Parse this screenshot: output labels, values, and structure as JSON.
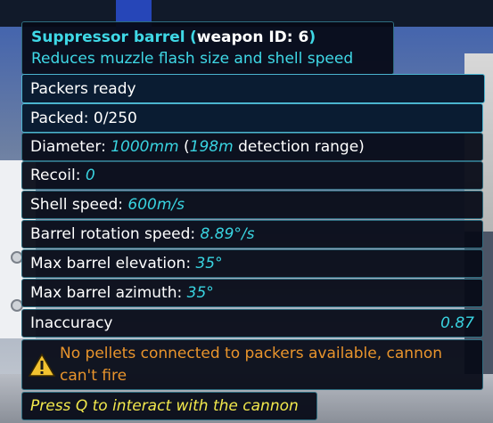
{
  "item": {
    "name": "Suppressor barrel",
    "id_prefix": "(",
    "id_label": "weapon ID: 6",
    "id_suffix": ")",
    "description": "Reduces muzzle flash size and shell speed"
  },
  "status": {
    "packers": "Packers ready",
    "packed_label": "Packed:",
    "packed_value": "0/250"
  },
  "stats": {
    "diameter_label": "Diameter:",
    "diameter_value": "1000mm",
    "diameter_open": "(",
    "detection_value": "198m",
    "detection_label": "detection range)",
    "recoil_label": "Recoil:",
    "recoil_value": "0",
    "shell_speed_label": "Shell speed:",
    "shell_speed_value": "600m/s",
    "rotation_label": "Barrel rotation speed:",
    "rotation_value": "8.89°/s",
    "elevation_label": "Max barrel elevation:",
    "elevation_value": "35°",
    "azimuth_label": "Max barrel azimuth:",
    "azimuth_value": "35°",
    "inaccuracy_label": "Inaccuracy",
    "inaccuracy_value": "0.87"
  },
  "warning": {
    "icon": "warning-triangle-icon",
    "line1": "No pellets connected to packers available, cannon",
    "line2": "can't fire"
  },
  "prompt": {
    "text": "Press Q to interact with the cannon"
  },
  "colors": {
    "accent": "#3fd8e6",
    "value": "#39d3e0",
    "warning": "#e8942c",
    "prompt": "#f2e84c",
    "panel_bg": "#060a16"
  }
}
